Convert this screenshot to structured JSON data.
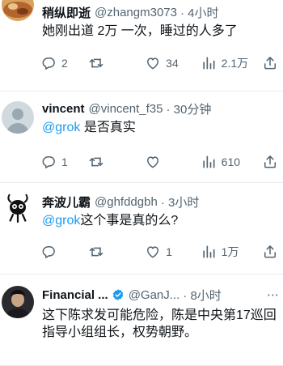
{
  "tweets": [
    {
      "name": "稍纵即逝",
      "handle": "@zhangm3073",
      "time": "· 4小时",
      "text": "她刚出道 2万 一次，睡过的人多了",
      "stats": {
        "replies": "2",
        "retweets": "",
        "likes": "34",
        "views": "2.1万"
      }
    },
    {
      "name": "vincent",
      "handle": "@vincent_f35",
      "time": "· 30分钟",
      "mention": "@grok",
      "text": " 是否真实",
      "stats": {
        "replies": "1",
        "retweets": "",
        "likes": "",
        "views": "610"
      }
    },
    {
      "name": "奔波儿霸",
      "handle": "@ghfddgbh",
      "time": "· 3小时",
      "mention": "@grok",
      "text": "这个事是真的么?",
      "stats": {
        "replies": "",
        "retweets": "",
        "likes": "1",
        "views": "1万"
      }
    },
    {
      "name": "Financial ...",
      "handle": "@GanJ...",
      "time": "· 8小时",
      "text": "这下陈求发可能危险，陈是中央第17巡回指导小组组长，权势朝野。"
    }
  ],
  "colors": {
    "accent": "#1d9bf0",
    "muted": "#536471",
    "text": "#0f1419"
  },
  "icons": [
    "reply-icon",
    "retweet-icon",
    "like-icon",
    "views-icon",
    "share-icon",
    "verified-icon",
    "more-icon"
  ]
}
